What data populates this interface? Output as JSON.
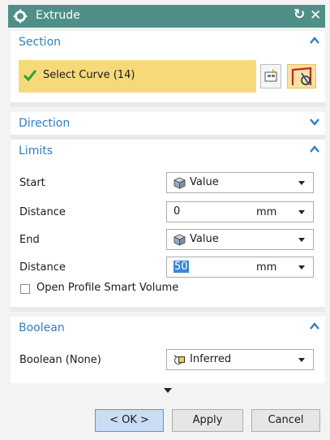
{
  "dialog": {
    "title": "Extrude"
  },
  "section": {
    "title": "Section",
    "select_label": "Select Curve (14)"
  },
  "direction": {
    "title": "Direction"
  },
  "limits": {
    "title": "Limits",
    "start_label": "Start",
    "start_value": "Value",
    "start_distance_label": "Distance",
    "start_distance_value": "0",
    "start_distance_unit": "mm",
    "end_label": "End",
    "end_value": "Value",
    "end_distance_label": "Distance",
    "end_distance_value": "50",
    "end_distance_unit": "mm",
    "open_profile_label": "Open Profile Smart Volume",
    "open_profile_checked": false
  },
  "boolean": {
    "title": "Boolean",
    "label": "Boolean (None)",
    "value": "Inferred"
  },
  "buttons": {
    "ok": "< OK >",
    "apply": "Apply",
    "cancel": "Cancel"
  },
  "colors": {
    "titlebar": "#4f8f87",
    "section_title": "#2d7fbf",
    "highlight": "#f7d97a",
    "check": "#2aa42a"
  },
  "icons": {
    "title": "gear-icon",
    "reset": "reset-icon",
    "close": "close-icon",
    "select_ok": "checkmark-icon",
    "curve_rule": "curve-rule-icon",
    "section_builder": "section-builder-icon",
    "value_mode": "cube-icon",
    "boolean": "boolean-inferred-icon"
  }
}
